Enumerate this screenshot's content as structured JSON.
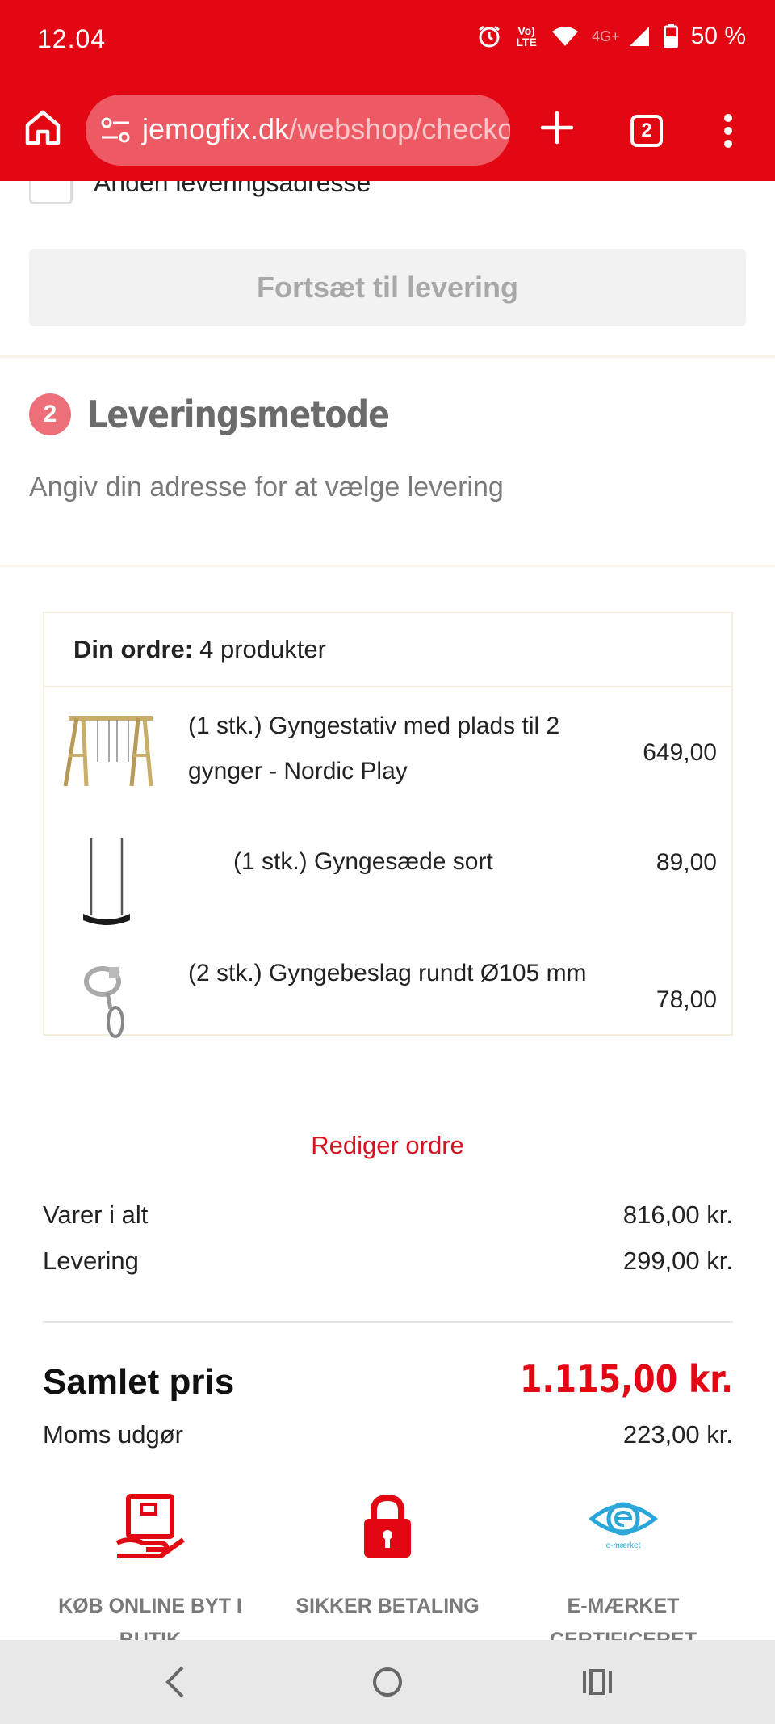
{
  "status_bar": {
    "time": "12.04",
    "network_volte": "Vo) LTE",
    "network_type": "4G+",
    "battery": "50 %"
  },
  "browser": {
    "url_host": "jemogfix.dk",
    "url_path": "/webshop/checkout",
    "tab_count": "2",
    "icons": [
      "home-icon",
      "tune-icon",
      "plus-icon",
      "tabs-icon",
      "more-vert-icon"
    ]
  },
  "shipping": {
    "alt_address_label": "Anden leveringsadresse",
    "continue_label": "Fortsæt til levering"
  },
  "delivery_step": {
    "number": "2",
    "title": "Leveringsmetode",
    "subtitle": "Angiv din adresse for at vælge levering"
  },
  "order": {
    "label": "Din ordre:",
    "count": "4 produkter",
    "items": [
      {
        "name": "(1 stk.) Gyngestativ med plads til 2 gynger - Nordic Play",
        "price": "649,00",
        "icon": "swing-frame-image"
      },
      {
        "name": "(1 stk.) Gyngesæde sort",
        "price": "89,00",
        "icon": "swing-seat-image"
      },
      {
        "name": "(2 stk.) Gyngebeslag rundt Ø105 mm",
        "price": "78,00",
        "icon": "swing-bracket-image"
      }
    ],
    "edit_label": "Rediger ordre"
  },
  "summary": {
    "items_label": "Varer i alt",
    "items_value": "816,00 kr.",
    "delivery_label": "Levering",
    "delivery_value": "299,00 kr.",
    "total_label": "Samlet pris",
    "total_value": "1.115,00 kr.",
    "vat_label": "Moms udgør",
    "vat_value": "223,00 kr."
  },
  "badges": [
    {
      "label": "KØB ONLINE BYT I BUTIK",
      "icon": "exchange-hand-icon"
    },
    {
      "label": "SIKKER BETALING",
      "icon": "lock-icon"
    },
    {
      "label": "E-MÆRKET CERTIFICERET",
      "icon": "emaerket-icon",
      "logo_text": "e-mærket"
    }
  ],
  "colors": {
    "brand_red": "#e30613",
    "step_badge": "#ed6f7a",
    "badge_blue": "#2aa7d8"
  },
  "navbar": {
    "icons": [
      "back-icon",
      "home-circle-icon",
      "recents-icon"
    ]
  }
}
